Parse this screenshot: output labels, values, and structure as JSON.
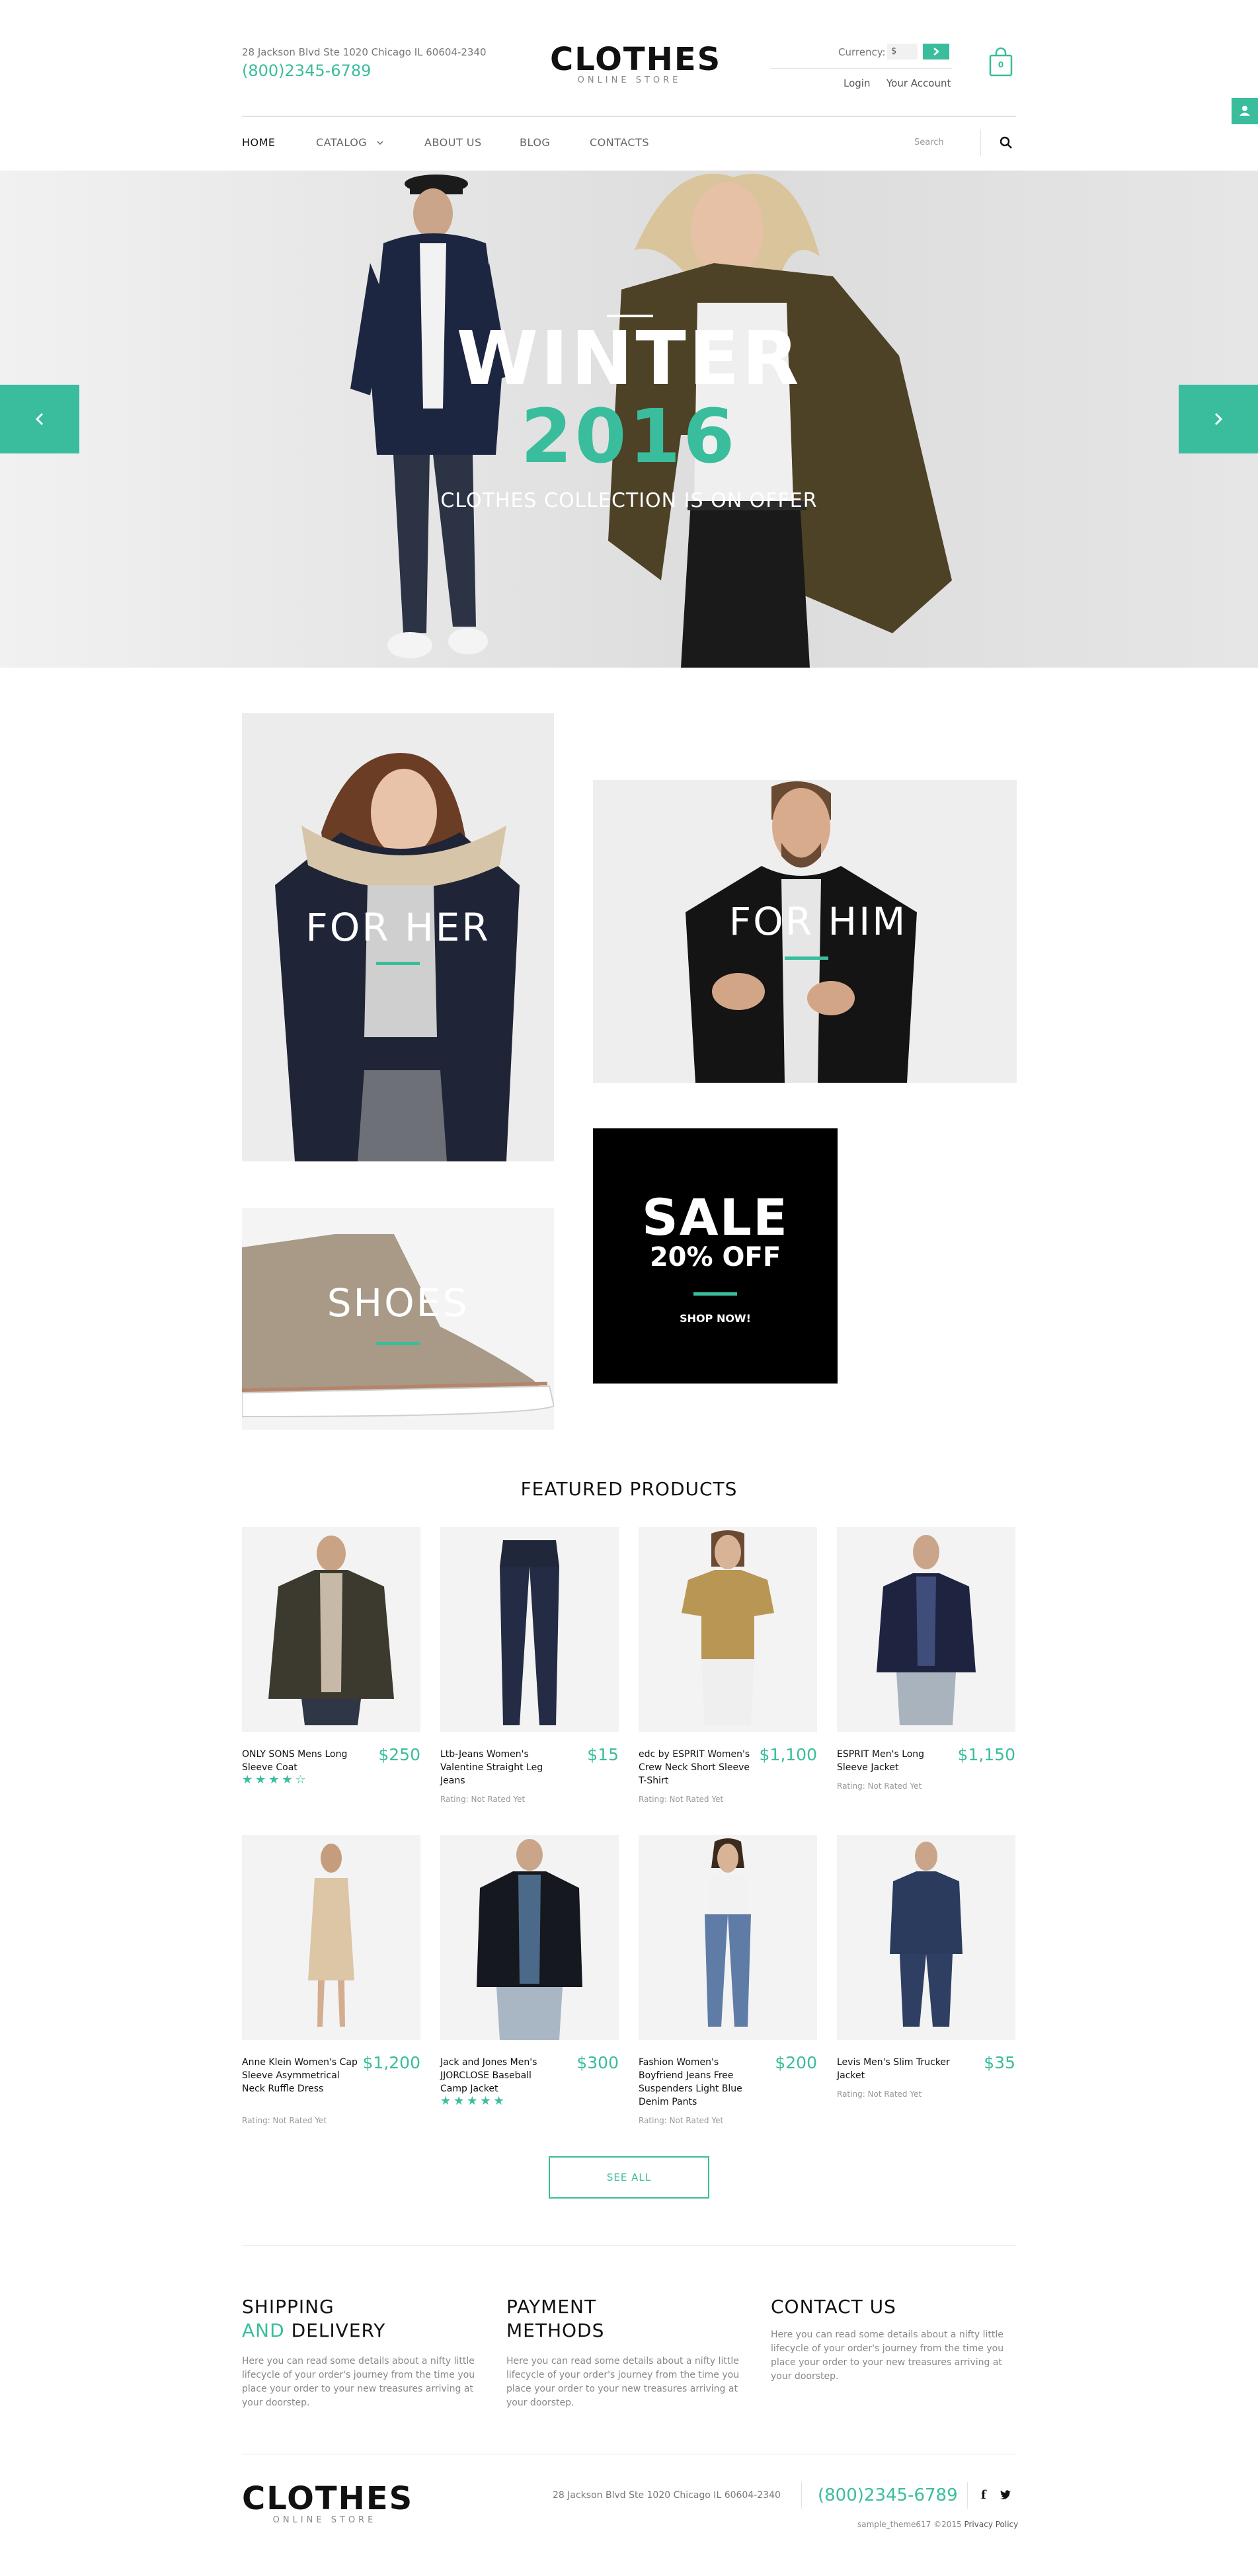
{
  "header": {
    "address": "28 Jackson Blvd Ste 1020 Chicago IL 60604-2340",
    "phone": "(800)2345-6789",
    "logo": "CLOTHES",
    "logo_sub": "ONLINE STORE",
    "currency_label": "Currency:",
    "currency_value": "$",
    "currency_button": ">",
    "login": "Login",
    "account": "Your Account",
    "cart_count": "0"
  },
  "nav": {
    "items": [
      {
        "label": "HOME",
        "active": true
      },
      {
        "label": "CATALOG",
        "has_dropdown": true
      },
      {
        "label": "ABOUT US"
      },
      {
        "label": "BLOG"
      },
      {
        "label": "CONTACTS"
      }
    ],
    "search_placeholder": "Search"
  },
  "hero": {
    "title": "WINTER",
    "year": "2016",
    "subtitle": "CLOTHES COLLECTION IS ON OFFER"
  },
  "categories": {
    "her": "FOR HER",
    "him": "FOR HIM",
    "shoes": "SHOES",
    "sale_title": "SALE",
    "sale_off": "20% OFF",
    "sale_cta": "SHOP NOW!"
  },
  "featured": {
    "title": "FEATURED PRODUCTS",
    "products": [
      {
        "name": "ONLY SONS Mens Long Sleeve Coat",
        "price": "$250",
        "rating": "",
        "stars": 4
      },
      {
        "name": "Ltb-Jeans Women's Valentine Straight Leg Jeans",
        "price": "$15",
        "rating": "Rating: Not Rated Yet",
        "stars": 0
      },
      {
        "name": "edc by ESPRIT Women's Crew Neck Short Sleeve T-Shirt",
        "price": "$1,100",
        "rating": "Rating: Not Rated Yet",
        "stars": 0
      },
      {
        "name": "ESPRIT Men's Long Sleeve Jacket",
        "price": "$1,150",
        "rating": "Rating: Not Rated Yet",
        "stars": 0
      },
      {
        "name": "Anne Klein Women's Cap Sleeve Asymmetrical Neck Ruffle Dress",
        "price": "$1,200",
        "rating": "Rating: Not Rated Yet",
        "stars": 0
      },
      {
        "name": "Jack and Jones Men's JJORCLOSE Baseball Camp Jacket",
        "price": "$300",
        "rating": "",
        "stars": 5
      },
      {
        "name": "Fashion Women's Boyfriend Jeans Free Suspenders Light Blue Denim Pants",
        "price": "$200",
        "rating": "Rating: Not Rated Yet",
        "stars": 0
      },
      {
        "name": "Levis Men's Slim Trucker Jacket",
        "price": "$35",
        "rating": "Rating: Not Rated Yet",
        "stars": 0
      }
    ],
    "see_all": "SEE ALL"
  },
  "info": {
    "shipping_title_1": "SHIPPING",
    "shipping_title_2a": "AND",
    "shipping_title_2b": " DELIVERY",
    "payment_title_1": "PAYMENT",
    "payment_title_2": "METHODS",
    "contact_title": "CONTACT US",
    "text": "Here you can read some details about a nifty little lifecycle of your order's journey from the time you place your order to your new treasures arriving at your doorstep."
  },
  "footer": {
    "logo": "CLOTHES",
    "logo_sub": "ONLINE STORE",
    "address": "28 Jackson Blvd Ste 1020 Chicago IL 60604-2340",
    "phone": "(800)2345-6789",
    "social_facebook": "f",
    "copyright_pre": "sample_theme617 ©2015 ",
    "copyright_link": "Privacy Policy"
  },
  "colors": {
    "accent": "#39bd9c",
    "text": "#111111",
    "muted": "#888888"
  }
}
